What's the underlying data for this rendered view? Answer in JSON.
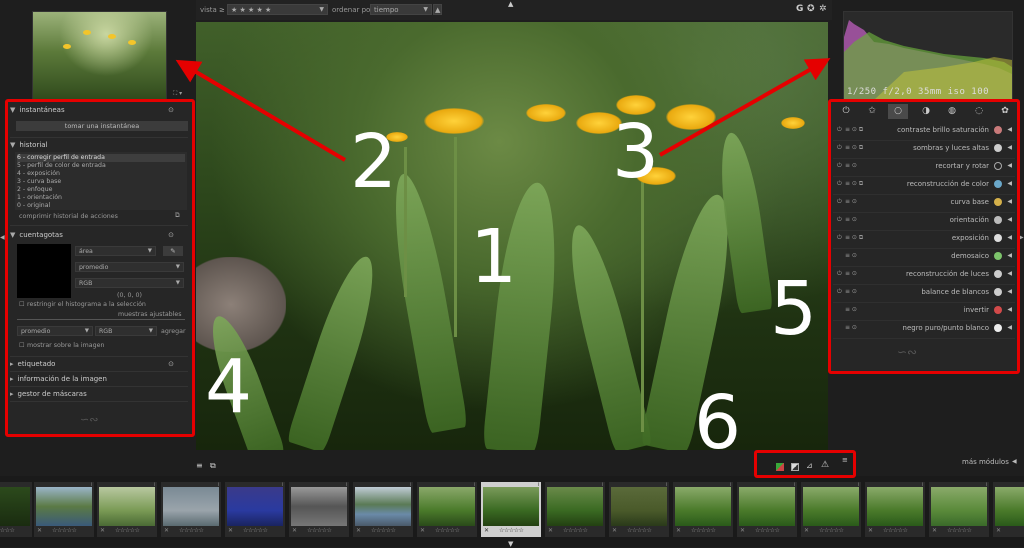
{
  "topbar": {
    "view_label": "vista",
    "compare_symbol": "≥",
    "rating_filter": "★ ★ ★ ★ ★",
    "sort_label": "ordenar por",
    "sort_value": "tiempo",
    "icons": [
      "G",
      "star-gear-icon",
      "gear-icon"
    ]
  },
  "left_panel": {
    "snapshots": {
      "title": "instantáneas",
      "button": "tomar una instantánea"
    },
    "history": {
      "title": "historial",
      "items": [
        "6 - corregir perfil de entrada",
        "5 - perfil de color de entrada",
        "4 - exposición",
        "3 - curva base",
        "2 - enfoque",
        "1 - orientación",
        "0 - original"
      ],
      "compress": "comprimir historial de acciones"
    },
    "color_picker": {
      "title": "cuentagotas",
      "area": "área",
      "mode": "promedio",
      "colorspace": "RGB",
      "values": "(0, 0, 0)",
      "restrict": "restringir el histograma a la selección",
      "samples": "muestras ajustables",
      "sample_mode": "promedio",
      "sample_space": "RGB",
      "add": "agregar",
      "show_on_image": "mostrar sobre la imagen"
    },
    "tagging": "etiquetado",
    "image_info": "información de la imagen",
    "mask_manager": "gestor de máscaras"
  },
  "histogram": {
    "info": "1/250 f/2,0 35mm iso 100"
  },
  "right_panel": {
    "modules": [
      {
        "name": "contraste brillo saturación",
        "color": "#c97a7a"
      },
      {
        "name": "sombras y luces altas",
        "color": "#cccccc"
      },
      {
        "name": "recortar y rotar",
        "color": "#aaaaaa"
      },
      {
        "name": "reconstrucción de color",
        "color": "#6aa7c9"
      },
      {
        "name": "curva base",
        "color": "#d4b04a"
      },
      {
        "name": "orientación",
        "color": "#bbbbbb"
      },
      {
        "name": "exposición",
        "color": "#dddddd"
      },
      {
        "name": "demosaico",
        "color": "#7cc36b"
      },
      {
        "name": "reconstrucción de luces",
        "color": "#cccccc"
      },
      {
        "name": "balance de blancos",
        "color": "#cccccc"
      },
      {
        "name": "invertir",
        "color": "#d24a4a"
      },
      {
        "name": "negro puro/punto blanco",
        "color": "#eeeeee"
      }
    ],
    "more_modules": "más módulos"
  },
  "annotations": {
    "n1": "1",
    "n2": "2",
    "n3": "3",
    "n4": "4",
    "n5": "5",
    "n6": "6",
    "accent": "#e50000"
  },
  "filmstrip": {
    "stars": "☆☆☆☆☆",
    "reject": "✕",
    "info": "i"
  }
}
